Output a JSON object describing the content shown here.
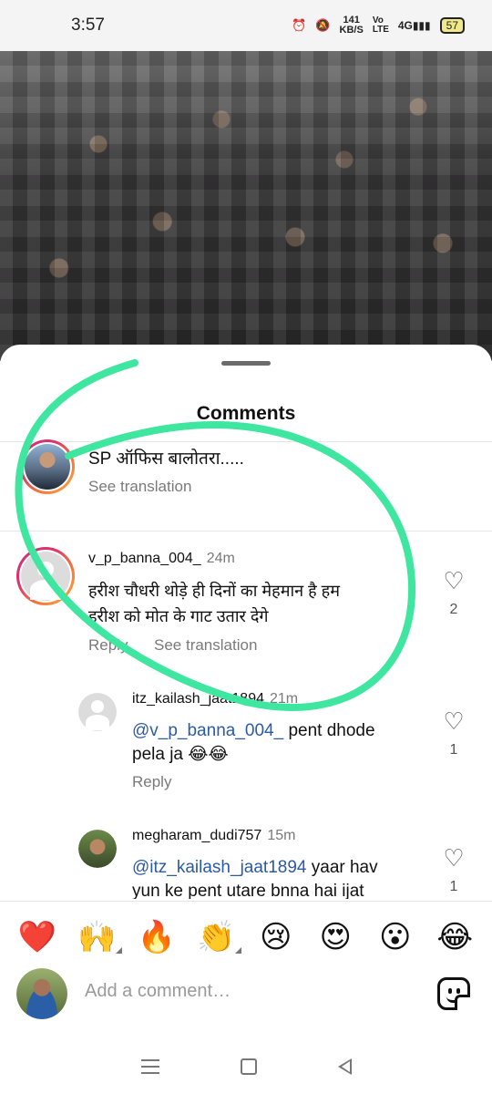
{
  "status_bar": {
    "time": "3:57",
    "net_speed_value": "141",
    "net_speed_unit": "KB/S",
    "volte": "Vo LTE",
    "network": "4G",
    "battery": "57"
  },
  "comments_sheet": {
    "title": "Comments",
    "caption": {
      "text": "SP ऑफिस बालोतरा.....",
      "see_translation": "See translation"
    },
    "comments": [
      {
        "username": "v_p_banna_004_",
        "time": "24m",
        "text_line1": "हरीश चौधरी थोड़े ही दिनों का मेहमान है हम",
        "text_line2": "हरीश को मोत के गाट उतार देगे",
        "reply": "Reply",
        "see_translation": "See translation",
        "likes": "2"
      },
      {
        "username": "itz_kailash_jaat1894",
        "time": "21m",
        "mention": "@v_p_banna_004_",
        "text_line1_rest": " pent dhode",
        "text_line2": "pela ja 😂😂",
        "reply": "Reply",
        "likes": "1"
      },
      {
        "username": "megharam_dudi757",
        "time": "15m",
        "mention": "@itz_kailash_jaat1894",
        "text_line1_rest": " yaar hav",
        "text_line2": "yun ke pent utare bnna hai ijat",
        "likes": "1"
      }
    ]
  },
  "quick_reactions": [
    "❤️",
    "🙌",
    "🔥",
    "👏",
    "😢",
    "😍",
    "😮",
    "😂"
  ],
  "composer": {
    "placeholder": "Add a comment…"
  },
  "colors": {
    "scribble": "#3ee6a0",
    "mention": "#2b5aa6",
    "story_ring": "#e1306c"
  },
  "icons": {
    "like": "heart-outline-icon",
    "sticker": "sticker-icon",
    "alarm": "alarm-icon",
    "mute": "mute-icon",
    "signal": "signal-icon"
  }
}
